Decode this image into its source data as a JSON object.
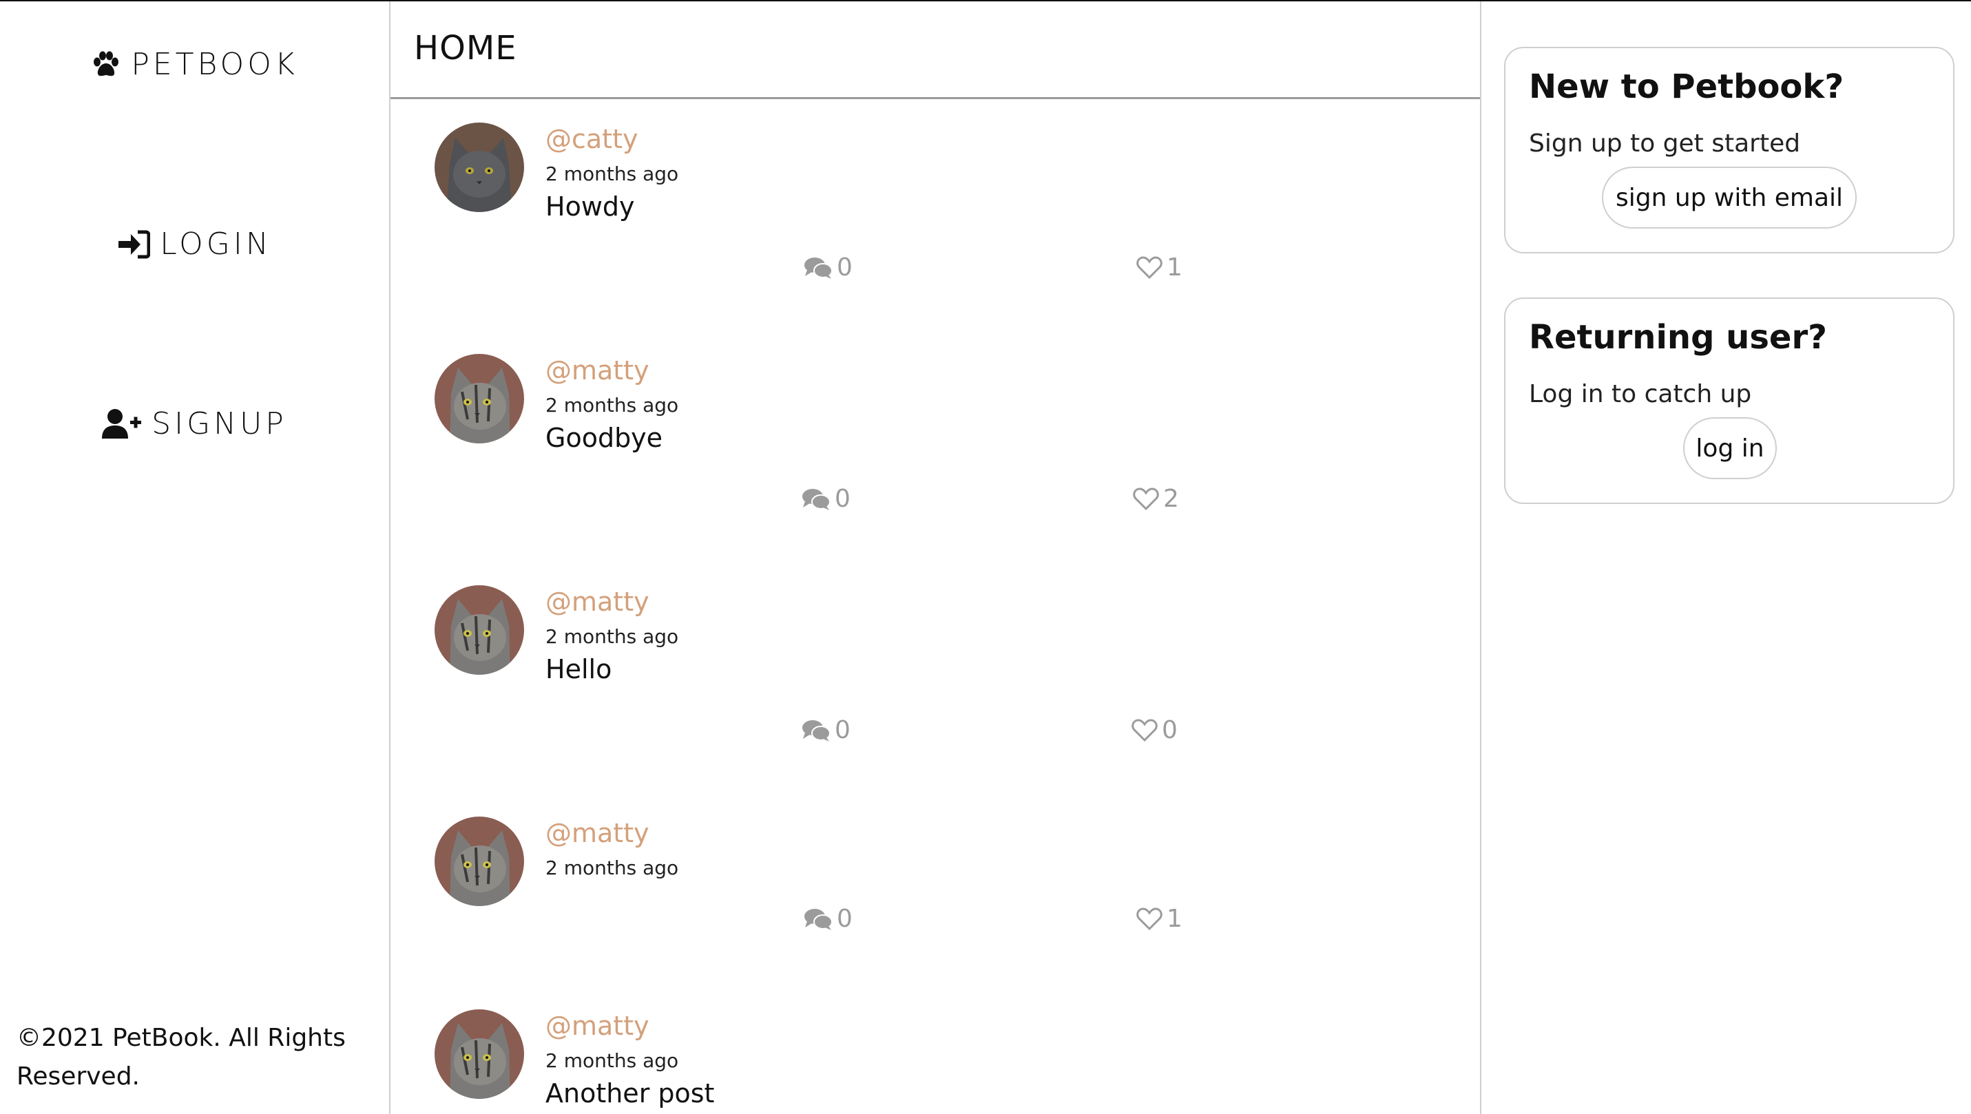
{
  "sidebar": {
    "brand": {
      "label": "PETBOOK",
      "icon": "paw-icon"
    },
    "login": {
      "label": "LOGIN",
      "icon": "sign-in-icon"
    },
    "signup": {
      "label": "SIGNUP",
      "icon": "user-plus-icon"
    },
    "copyright": "©2021 PetBook. All Rights Reserved."
  },
  "main": {
    "title": "HOME",
    "posts": [
      {
        "user": "@catty",
        "time": "2 months ago",
        "body": "Howdy",
        "comments": "0",
        "likes": "1"
      },
      {
        "user": "@matty",
        "time": "2 months ago",
        "body": "Goodbye",
        "comments": "0",
        "likes": "2"
      },
      {
        "user": "@matty",
        "time": "2 months ago",
        "body": "Hello",
        "comments": "0",
        "likes": "0"
      },
      {
        "user": "@matty",
        "time": "2 months ago",
        "body": "",
        "comments": "0",
        "likes": "1"
      },
      {
        "user": "@matty",
        "time": "2 months ago",
        "body": "Another post",
        "comments": "",
        "likes": ""
      }
    ]
  },
  "right": {
    "signup_card": {
      "title": "New to Petbook?",
      "text": "Sign up to get started",
      "button": "sign up with email"
    },
    "login_card": {
      "title": "Returning user?",
      "text": "Log in to catch up",
      "button": "log in"
    }
  },
  "colors": {
    "username": "#d4a07b",
    "action": "#9b9b9b",
    "border": "#cfcfcf"
  }
}
